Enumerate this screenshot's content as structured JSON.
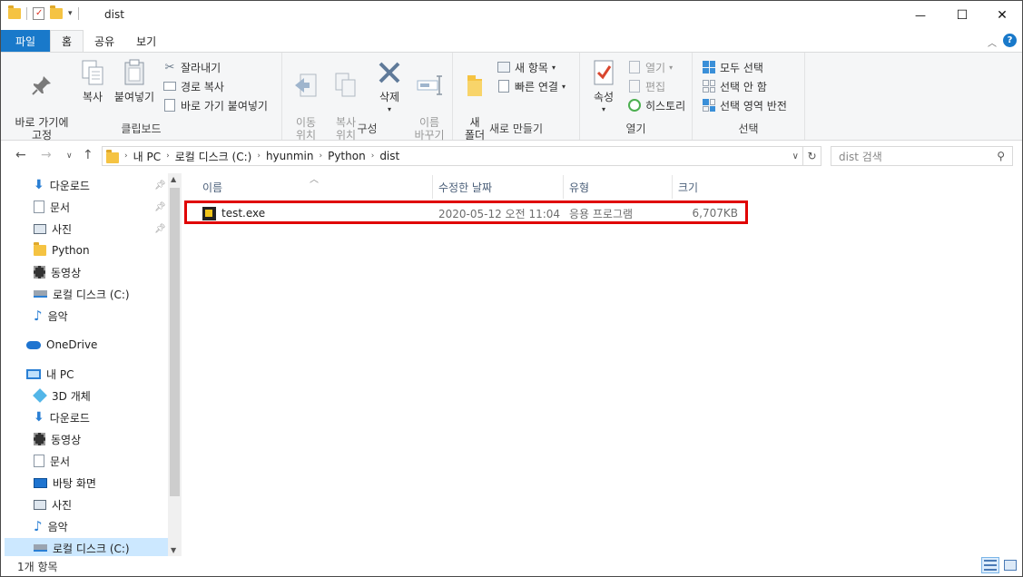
{
  "window": {
    "title": "dist",
    "controls": {
      "minimize": "—",
      "maximize": "☐",
      "close": "✕"
    }
  },
  "ribbon_tabs": [
    "파일",
    "홈",
    "공유",
    "보기"
  ],
  "ribbon": {
    "clipboard": {
      "label": "클립보드",
      "pin_quick_access": "바로 가기에\n고정",
      "copy": "복사",
      "paste": "붙여넣기",
      "cut": "잘라내기",
      "copy_path": "경로 복사",
      "paste_shortcut": "바로 가기 붙여넣기"
    },
    "organize": {
      "label": "구성",
      "move_to": "이동\n위치",
      "copy_to": "복사\n위치",
      "delete": "삭제",
      "rename": "이름\n바꾸기"
    },
    "new": {
      "label": "새로 만들기",
      "new_folder": "새\n폴더",
      "new_item": "새 항목",
      "easy_access": "빠른 연결"
    },
    "open": {
      "label": "열기",
      "properties": "속성",
      "open": "열기",
      "edit": "편집",
      "history": "히스토리"
    },
    "select": {
      "label": "선택",
      "select_all": "모두 선택",
      "select_none": "선택 안 함",
      "invert": "선택 영역 반전"
    }
  },
  "address": {
    "crumbs": [
      "내 PC",
      "로컬 디스크 (C:)",
      "hyunmin",
      "Python",
      "dist"
    ],
    "search_placeholder": "dist 검색"
  },
  "nav": {
    "quick": [
      {
        "label": "다운로드",
        "icon": "download-icon",
        "pinned": true
      },
      {
        "label": "문서",
        "icon": "document-icon",
        "pinned": true
      },
      {
        "label": "사진",
        "icon": "picture-icon",
        "pinned": true
      },
      {
        "label": "Python",
        "icon": "folder-icon",
        "pinned": false
      },
      {
        "label": "동영상",
        "icon": "video-icon",
        "pinned": false
      },
      {
        "label": "로컬 디스크 (C:)",
        "icon": "drive-icon",
        "pinned": false
      },
      {
        "label": "음악",
        "icon": "music-icon",
        "pinned": false
      }
    ],
    "onedrive": "OneDrive",
    "thispc": "내 PC",
    "pc_items": [
      {
        "label": "3D 개체",
        "icon": "3d-objects-icon"
      },
      {
        "label": "다운로드",
        "icon": "download-icon"
      },
      {
        "label": "동영상",
        "icon": "video-icon"
      },
      {
        "label": "문서",
        "icon": "document-icon"
      },
      {
        "label": "바탕 화면",
        "icon": "desktop-icon"
      },
      {
        "label": "사진",
        "icon": "picture-icon"
      },
      {
        "label": "음악",
        "icon": "music-icon"
      },
      {
        "label": "로컬 디스크 (C:)",
        "icon": "drive-icon",
        "selected": true
      }
    ]
  },
  "columns": [
    "이름",
    "수정한 날짜",
    "유형",
    "크기"
  ],
  "files": [
    {
      "name": "test.exe",
      "modified": "2020-05-12 오전 11:04",
      "type": "응용 프로그램",
      "size": "6,707KB",
      "icon": "exe-icon"
    }
  ],
  "status": {
    "count": "1개 항목"
  },
  "colors": {
    "accent": "#1979ca",
    "highlight_border": "#e00000",
    "selection": "#cce8ff"
  }
}
